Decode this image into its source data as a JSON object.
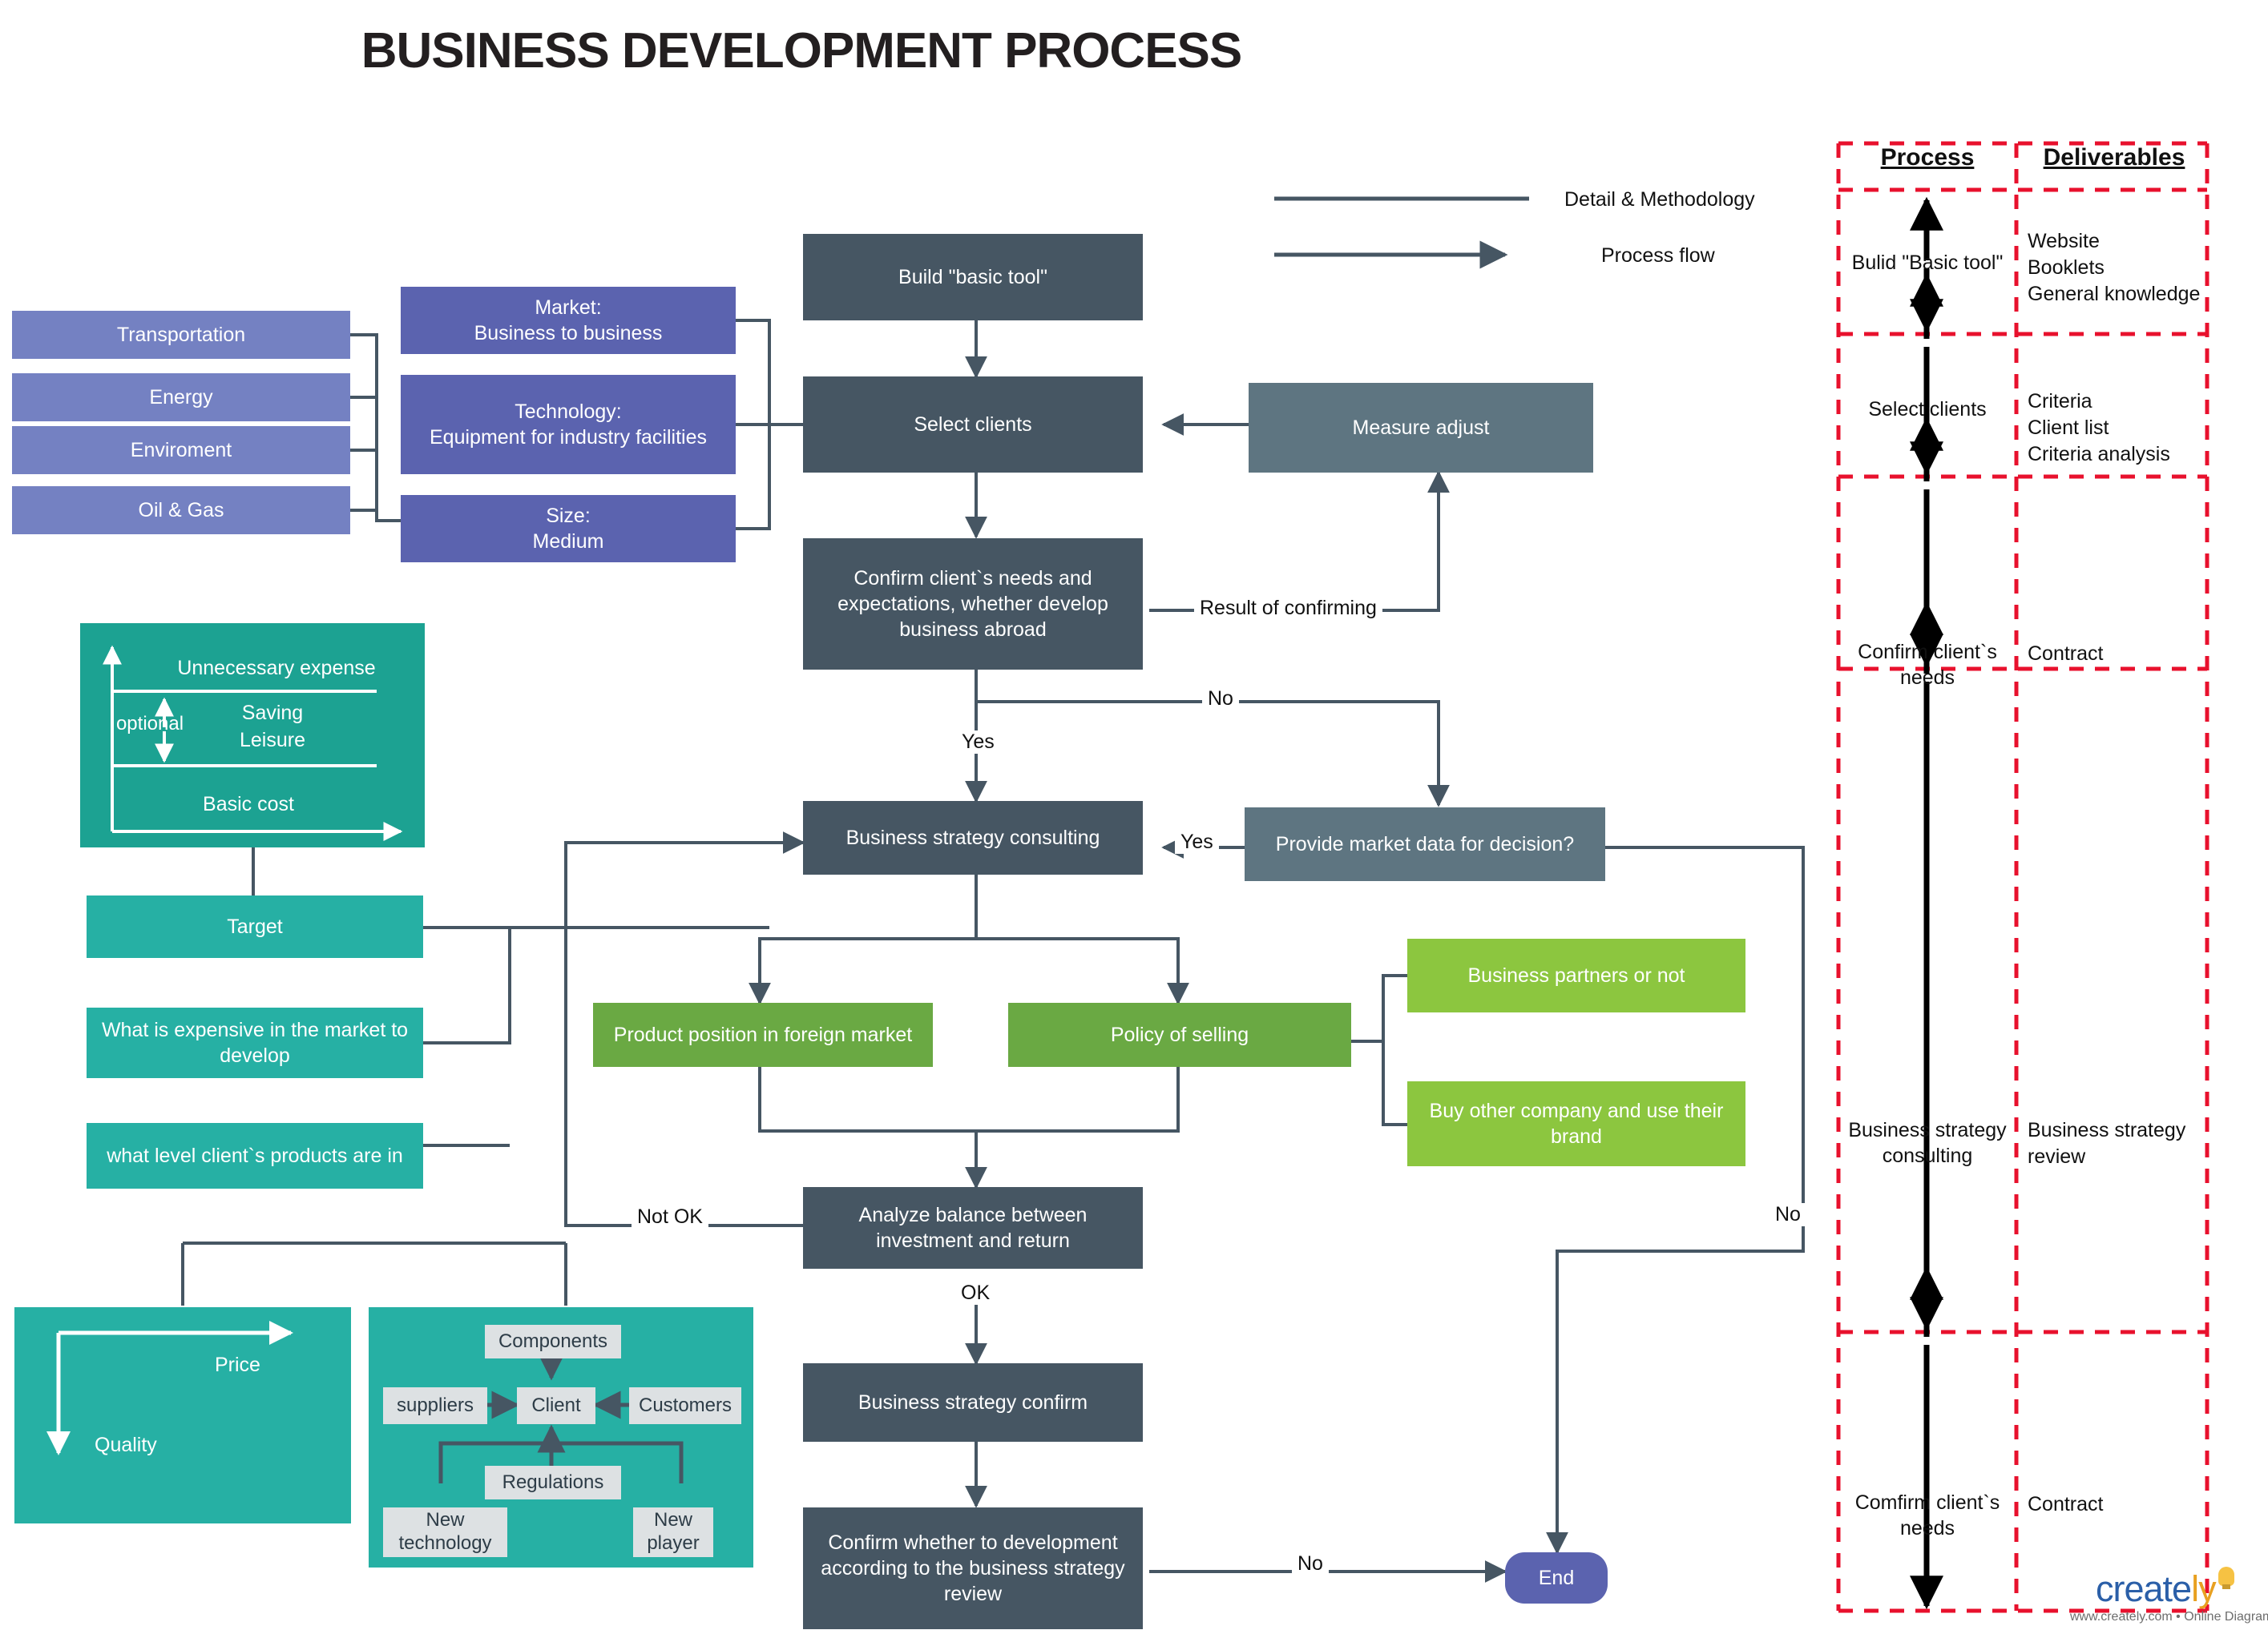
{
  "title": "BUSINESS DEVELOPMENT PROCESS",
  "legend": {
    "detail_label": "Detail & Methodology",
    "process_label": "Process flow"
  },
  "industry_boxes": [
    {
      "label": "Transportation"
    },
    {
      "label": "Energy"
    },
    {
      "label": "Enviroment"
    },
    {
      "label": "Oil & Gas"
    }
  ],
  "criteria_boxes": [
    {
      "line1": "Market:",
      "line2": "Business to business"
    },
    {
      "line1": "Technology:",
      "line2": "Equipment for industry facilities"
    },
    {
      "line1": "Size:",
      "line2": "Medium"
    }
  ],
  "cost_chart": {
    "top_label": "Unnecessary expense",
    "mid_label_1": "Saving",
    "mid_label_2": "Leisure",
    "optional_label": "optional",
    "bottom_label": "Basic cost"
  },
  "target_boxes": [
    {
      "label": "Target"
    },
    {
      "label": "What is expensive in the market to develop"
    },
    {
      "label": "what level client`s products are in"
    }
  ],
  "price_quality": {
    "price_label": "Price",
    "quality_label": "Quality"
  },
  "forces": {
    "components": "Components",
    "suppliers": "suppliers",
    "client": "Client",
    "customers": "Customers",
    "regulations": "Regulations",
    "new_technology": "New technology",
    "new_player": "New player"
  },
  "flow_nodes": {
    "build_basic_tool": "Build \"basic tool\"",
    "select_clients": "Select clients",
    "measure_adjust": "Measure adjust",
    "confirm_needs": "Confirm client`s needs and expectations, whether develop business abroad",
    "business_strategy_consulting": "Business strategy consulting",
    "provide_market_data": "Provide market data for decision?",
    "product_position": "Product position in foreign market",
    "policy_of_selling": "Policy of selling",
    "business_partners": "Business partners or not",
    "buy_other_company": "Buy other company and use their brand",
    "analyze_balance": "Analyze balance between investment and return",
    "business_strategy_confirm": "Business strategy confirm",
    "confirm_development": "Confirm whether to development according to the business strategy review",
    "end": "End"
  },
  "edge_labels": {
    "result_of_confirming": "Result of confirming",
    "no_1": "No",
    "yes_1": "Yes",
    "yes_2": "Yes",
    "no_right": "No",
    "not_ok": "Not OK",
    "ok": "OK",
    "no_end": "No"
  },
  "swimlane": {
    "header_process": "Process",
    "header_deliverables": "Deliverables",
    "rows": [
      {
        "process": "Bulid \"Basic tool\"",
        "deliverables": [
          "Website",
          "Booklets",
          "General knowledge"
        ]
      },
      {
        "process": "Select clients",
        "deliverables": [
          "Criteria",
          "Client list",
          "Criteria analysis"
        ]
      },
      {
        "process": "Confirm client`s needs",
        "deliverables": [
          "Contract"
        ]
      },
      {
        "process": "Business strategy consulting",
        "deliverables": [
          "Business strategy review"
        ]
      },
      {
        "process": "Comfirm client`s needs",
        "deliverables": [
          "Contract"
        ]
      }
    ]
  },
  "branding": {
    "name_part1": "create",
    "name_part2": "ly",
    "url": "www.creately.com • Online Diagramming"
  },
  "colors": {
    "slate": "#465663",
    "slate_light": "#5e7581",
    "purple": "#5b63af",
    "purple_light": "#7481c2",
    "teal": "#26b0a4",
    "green": "#6aa943",
    "green_light": "#8cc63f",
    "swimlane_red": "#e8112d"
  }
}
